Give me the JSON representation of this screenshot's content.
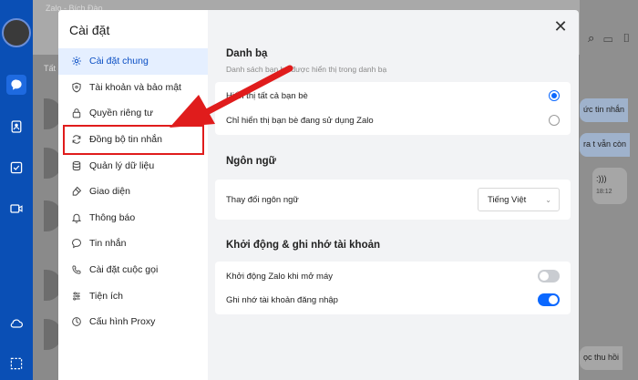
{
  "background": {
    "window_title": "Zalo - Bích Đào",
    "tab_label": "Tất",
    "bubbles": [
      "ức tin nhắn",
      "ra t vẫn còn"
    ],
    "emoji_bubble": ":)))",
    "emoji_time": "18:12",
    "bottom_bubble": "ọc thu hồi"
  },
  "modal": {
    "title": "Cài đặt",
    "menu": [
      {
        "label": "Cài đặt chung",
        "icon": "gear-icon",
        "active": true
      },
      {
        "label": "Tài khoản và bảo mật",
        "icon": "shield-icon",
        "active": false
      },
      {
        "label": "Quyền riêng tư",
        "icon": "lock-icon",
        "active": false
      },
      {
        "label": "Đồng bộ tin nhắn",
        "icon": "sync-icon",
        "active": false
      },
      {
        "label": "Quản lý dữ liệu",
        "icon": "database-icon",
        "active": false
      },
      {
        "label": "Giao diện",
        "icon": "palette-icon",
        "active": false
      },
      {
        "label": "Thông báo",
        "icon": "bell-icon",
        "active": false
      },
      {
        "label": "Tin nhắn",
        "icon": "message-icon",
        "active": false
      },
      {
        "label": "Cài đặt cuộc gọi",
        "icon": "phone-icon",
        "active": false
      },
      {
        "label": "Tiện ích",
        "icon": "utilities-icon",
        "active": false
      },
      {
        "label": "Cấu hình Proxy",
        "icon": "proxy-icon",
        "active": false
      }
    ],
    "contacts": {
      "title": "Danh bạ",
      "subtitle": "Danh sách bạn bè được hiển thị trong danh bạ",
      "options": [
        {
          "label": "Hiển thị tất cả bạn bè",
          "checked": true
        },
        {
          "label": "Chỉ hiển thị bạn bè đang sử dụng Zalo",
          "checked": false
        }
      ]
    },
    "language": {
      "title": "Ngôn ngữ",
      "row_label": "Thay đổi ngôn ngữ",
      "selected": "Tiếng Việt"
    },
    "startup": {
      "title": "Khởi động & ghi nhớ tài khoản",
      "rows": [
        {
          "label": "Khởi động Zalo khi mở máy",
          "on": false
        },
        {
          "label": "Ghi nhớ tài khoản đăng nhập",
          "on": true
        }
      ]
    }
  },
  "colors": {
    "accent": "#0b68ff",
    "highlight": "#e01c1c",
    "rail": "#0a4fb5"
  }
}
